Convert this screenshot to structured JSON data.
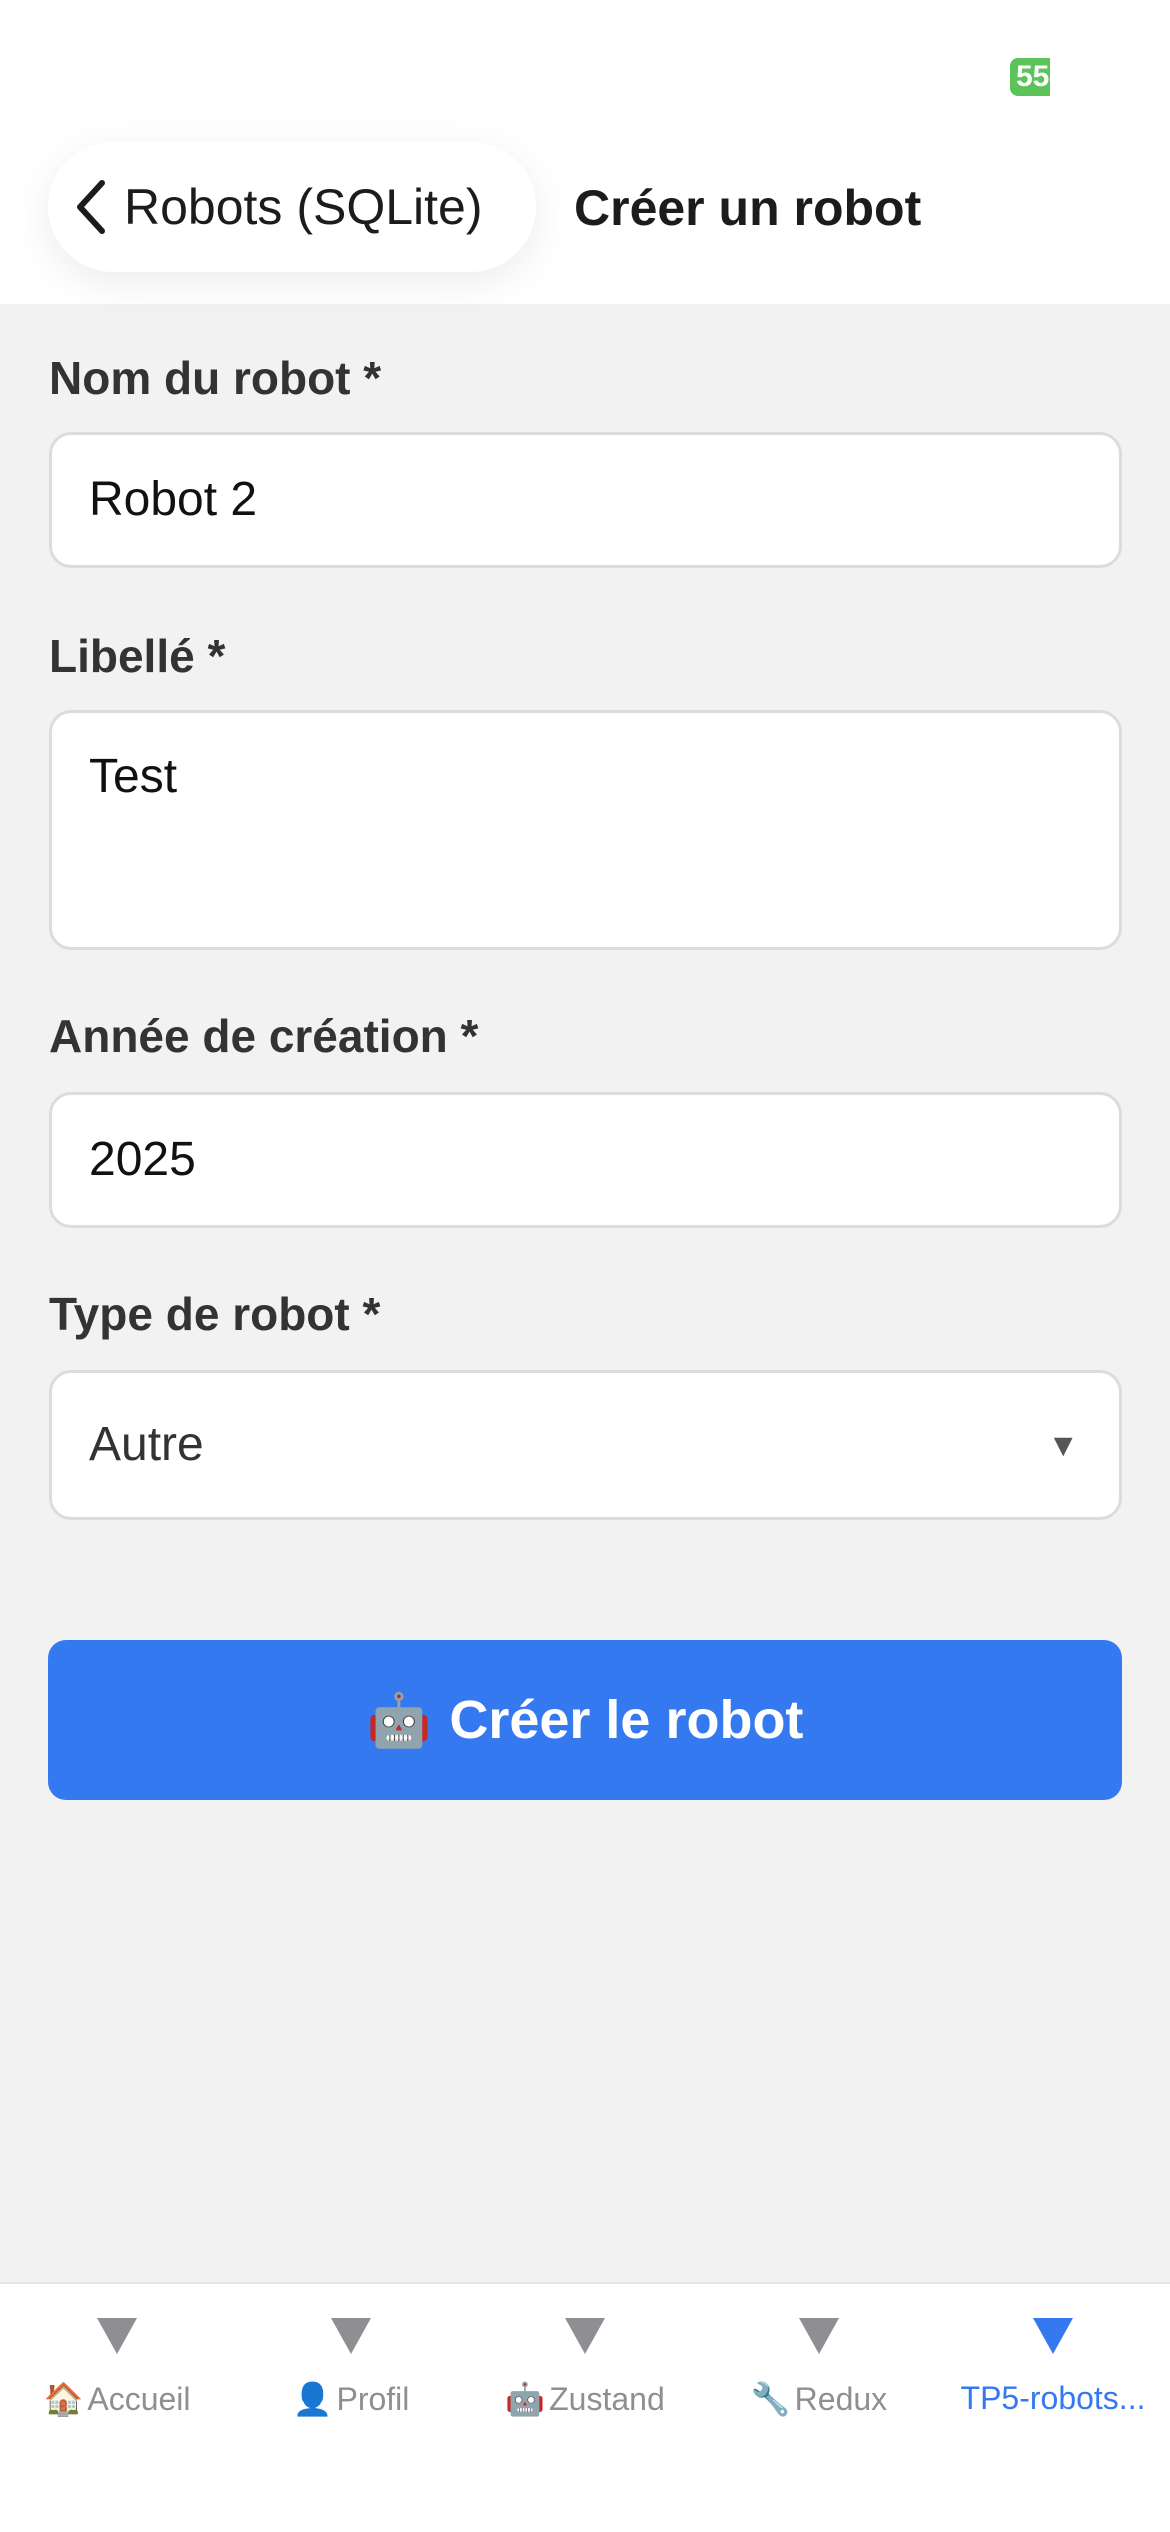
{
  "status_bar": {
    "battery_level": "55"
  },
  "header": {
    "back_label": "Robots (SQLite)",
    "title": "Créer un robot"
  },
  "form": {
    "name": {
      "label": "Nom du robot *",
      "value": "Robot 2"
    },
    "libelle": {
      "label": "Libellé *",
      "value": "Test"
    },
    "year": {
      "label": "Année de création *",
      "value": "2025"
    },
    "type": {
      "label": "Type de robot *",
      "value": "Autre",
      "arrow": "▼"
    }
  },
  "create_button": {
    "emoji": "🤖",
    "label": "Créer le robot"
  },
  "tabs": [
    {
      "icon": "🏠",
      "label": "Accueil",
      "active": false
    },
    {
      "icon": "👤",
      "label": "Profil",
      "active": false
    },
    {
      "icon": "🤖",
      "label": "Zustand",
      "active": false
    },
    {
      "icon": "🔧",
      "label": "Redux",
      "active": false
    },
    {
      "icon": "",
      "label": "TP5-robots...",
      "active": true
    }
  ],
  "colors": {
    "accent": "#3579f0",
    "battery": "#5cc35a",
    "inactive_tab": "#8e8e93"
  }
}
